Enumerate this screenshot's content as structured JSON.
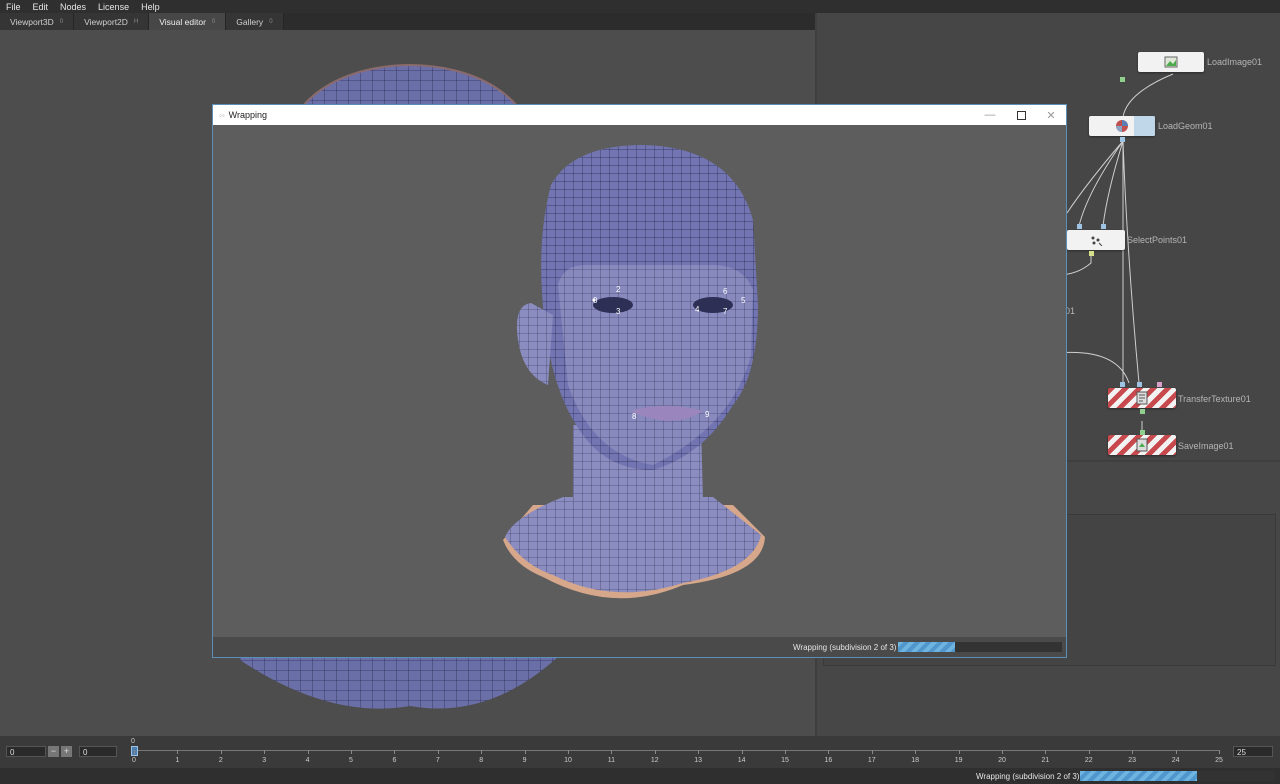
{
  "menu": [
    "File",
    "Edit",
    "Nodes",
    "License",
    "Help"
  ],
  "tabs": [
    {
      "label": "Viewport3D",
      "key": "0"
    },
    {
      "label": "Viewport2D",
      "key": "H"
    },
    {
      "label": "Visual editor",
      "key": "0"
    },
    {
      "label": "Gallery",
      "key": "0"
    }
  ],
  "nodes": {
    "load_image": "LoadImage01",
    "load_geom": "LoadGeom01",
    "select_points": "SelectPoints01",
    "partial_label": "01",
    "transfer_texture": "TransferTexture01",
    "save_image": "SaveImage01"
  },
  "dialog": {
    "title": "Wrapping",
    "status": "Wrapping (subdivision 2 of 3)",
    "progress": 0.35
  },
  "landmarks": [
    "0",
    "2",
    "3",
    "4",
    "6",
    "5",
    "7",
    "8",
    "9"
  ],
  "timeline": {
    "start": "0",
    "current": "0",
    "end": "25",
    "marker": "0",
    "ticks": [
      "0",
      "1",
      "2",
      "3",
      "4",
      "5",
      "6",
      "7",
      "8",
      "9",
      "10",
      "11",
      "12",
      "13",
      "14",
      "15",
      "16",
      "17",
      "18",
      "19",
      "20",
      "21",
      "22",
      "23",
      "24",
      "25"
    ],
    "minus": "−",
    "plus": "+"
  },
  "status": {
    "text": "Wrapping (subdivision 2 of 3)",
    "progress": 0.6
  },
  "colors": {
    "accent": "#5a8fb8",
    "progress": "#6fb3e0",
    "hatch": "#c8494d"
  }
}
